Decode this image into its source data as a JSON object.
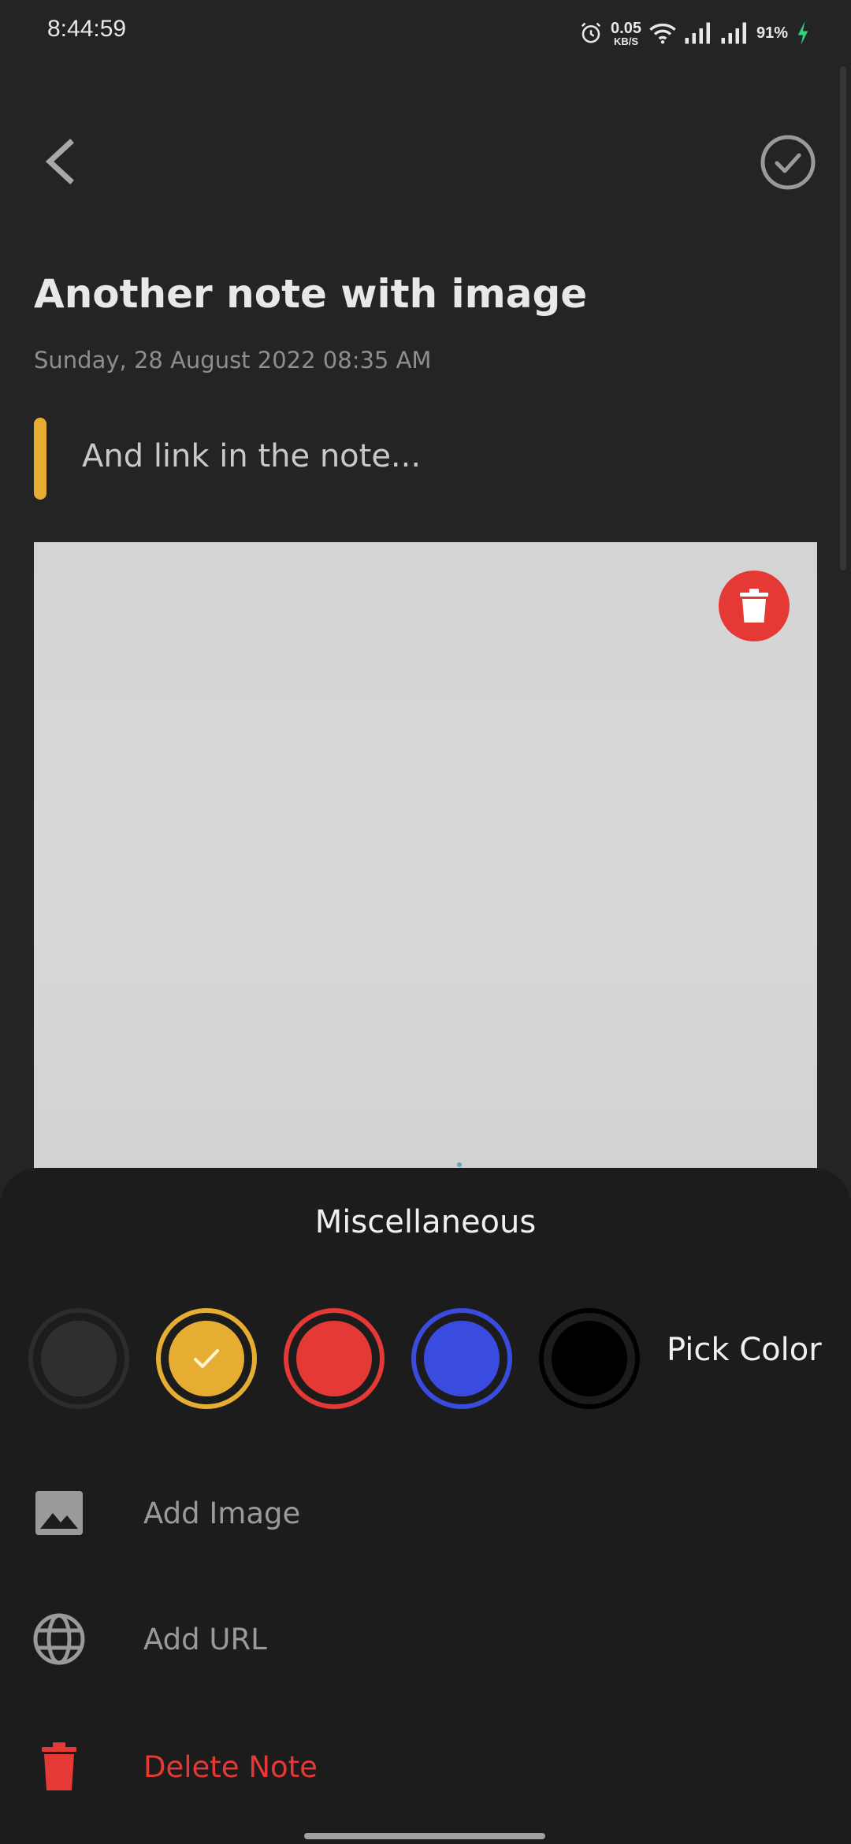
{
  "status_bar": {
    "time": "8:44:59",
    "net_speed_value": "0.05",
    "net_speed_unit": "KB/S",
    "battery": "91%"
  },
  "toolbar": {
    "back_icon": "chevron-left-icon",
    "done_icon": "check-circle-icon"
  },
  "note": {
    "title": "Another note with image",
    "date": "Sunday, 28 August 2022 08:35 AM",
    "subtitle": "And link in the note...",
    "accent_color": "#E5AE32",
    "image": {
      "remove_icon": "trash-icon"
    }
  },
  "sheet": {
    "title": "Miscellaneous",
    "colors": [
      {
        "name": "default",
        "hex": "#333333",
        "selected": false
      },
      {
        "name": "yellow",
        "hex": "#E5AE32",
        "selected": true
      },
      {
        "name": "red",
        "hex": "#E53935",
        "selected": false
      },
      {
        "name": "blue",
        "hex": "#3A4BE0",
        "selected": false
      },
      {
        "name": "black",
        "hex": "#000000",
        "selected": false
      }
    ],
    "pick_color_label": "Pick Color",
    "items": [
      {
        "label": "Add Image",
        "icon": "image-icon"
      },
      {
        "label": "Add URL",
        "icon": "globe-icon"
      },
      {
        "label": "Delete Note",
        "icon": "trash-icon"
      }
    ]
  },
  "colors": {
    "background": "#242424",
    "sheet": "#1C1C1C",
    "danger": "#E53935",
    "accent": "#E5AE32"
  }
}
